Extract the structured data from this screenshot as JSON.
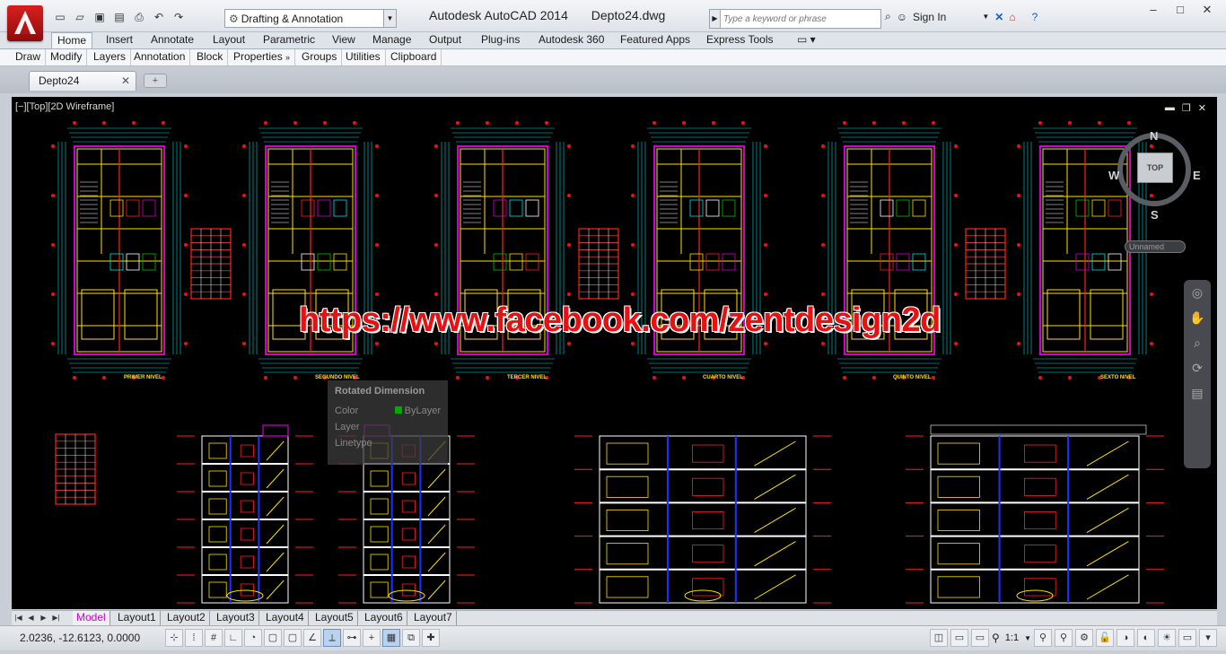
{
  "app": {
    "name": "Autodesk AutoCAD 2014",
    "file": "Depto24.dwg",
    "workspace": "Drafting & Annotation",
    "search_placeholder": "Type a keyword or phrase",
    "sign_in": "Sign In"
  },
  "ribbon": {
    "tabs": [
      "Home",
      "Insert",
      "Annotate",
      "Layout",
      "Parametric",
      "View",
      "Manage",
      "Output",
      "Plug-ins",
      "Autodesk 360",
      "Featured Apps",
      "Express Tools"
    ],
    "active_tab": "Home",
    "panels": [
      "Draw",
      "Modify",
      "Layers",
      "Annotation",
      "Block",
      "Properties",
      "Groups",
      "Utilities",
      "Clipboard"
    ]
  },
  "document_tab": "Depto24",
  "viewport": {
    "label": "[−][Top][2D Wireframe]",
    "watermark": "https://www.facebook.com/zentdesign2d"
  },
  "viewcube": {
    "top": "TOP",
    "north": "N",
    "south": "S",
    "east": "E",
    "west": "W",
    "ucs": "Unnamed"
  },
  "tooltip": {
    "title": "Rotated Dimension",
    "color_label": "Color",
    "color_value": "ByLayer",
    "layer_label": "Layer",
    "linetype_label": "Linetype"
  },
  "plan_labels": [
    "PRIMER NIVEL",
    "SEGUNDO NIVEL",
    "TERCER NIVEL",
    "CUARTO NIVEL",
    "QUINTO NIVEL",
    "SEXTO NIVEL"
  ],
  "layout_tabs": [
    "Model",
    "Layout1",
    "Layout2",
    "Layout3",
    "Layout4",
    "Layout5",
    "Layout6",
    "Layout7"
  ],
  "status": {
    "coordinates": "2.0236,   -12.6123, 0.0000",
    "annotation_scale": "1:1"
  },
  "colors": {
    "canvas": "#000000",
    "watermark": "#e81010",
    "active_layout_tab": "#d000d0"
  }
}
